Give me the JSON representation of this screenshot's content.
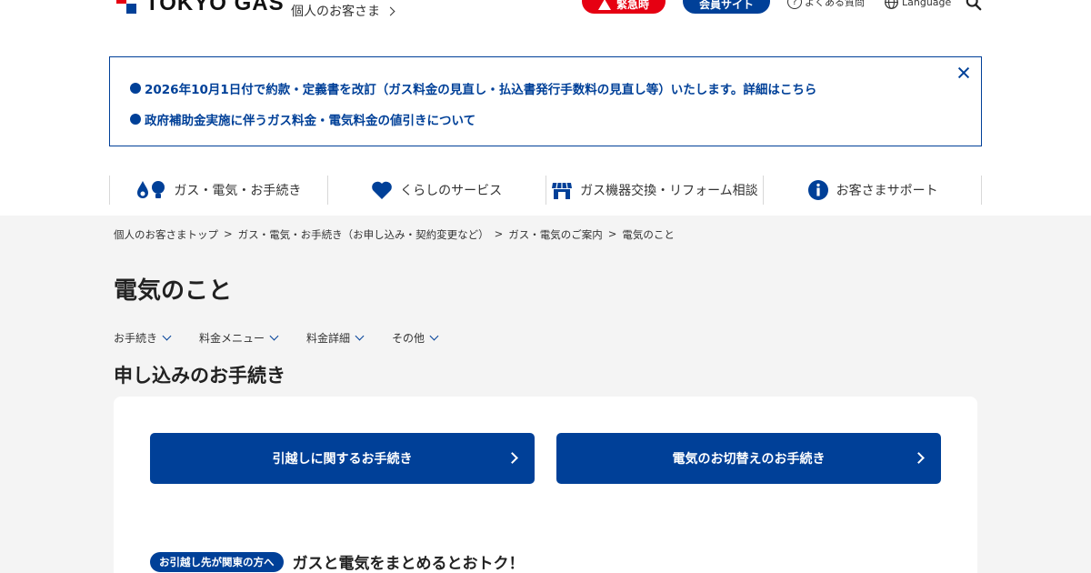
{
  "header": {
    "logo_text": "TOKYO GAS",
    "personal_link": "個人のお客さま",
    "emergency_label": "緊急時",
    "member_label": "会員サイト",
    "faq_label": "よくある質問",
    "language_label": "Language"
  },
  "notice": {
    "items": [
      "2026年10月1日付で約款・定義書を改訂（ガス料金の見直し・払込書発行手数料の見直し等）いたします。詳細はこちら",
      "政府補助金実施に伴うガス料金・電気料金の値引きについて"
    ]
  },
  "gnav": {
    "items": [
      {
        "label": "ガス・電気・お手続き",
        "icon": "gas-electric-icon"
      },
      {
        "label": "くらしのサービス",
        "icon": "heart-icon"
      },
      {
        "label": "ガス機器交換・リフォーム相談",
        "icon": "shop-icon"
      },
      {
        "label": "お客さまサポート",
        "icon": "info-icon"
      }
    ]
  },
  "breadcrumb": [
    "個人のお客さまトップ",
    "ガス・電気・お手続き（お申し込み・契約変更など）",
    "ガス・電気のご案内",
    "電気のこと"
  ],
  "page_title": "電気のこと",
  "subnav": [
    "お手続き",
    "料金メニュー",
    "料金詳細",
    "その他"
  ],
  "section_title": "申し込みのお手続き",
  "buttons": {
    "moving": "引越しに関するお手続き",
    "switch": "電気のお切替えのお手続き"
  },
  "promo": {
    "badge": "お引越し先が関東の方へ",
    "text": "ガスと電気をまとめるとおトク！"
  },
  "colors": {
    "brand_blue": "#004098",
    "emergency_red": "#e60012",
    "bg_gray": "#f4f4f4"
  }
}
